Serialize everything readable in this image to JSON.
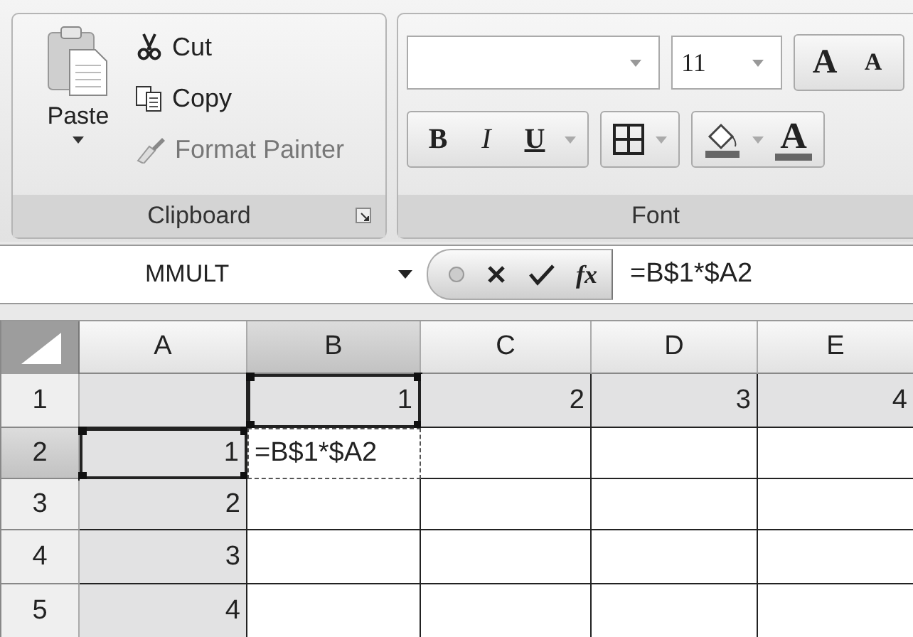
{
  "ribbon": {
    "clipboard": {
      "paste": "Paste",
      "items": [
        {
          "kind": "cut",
          "label": "Cut",
          "disabled": false
        },
        {
          "kind": "copy",
          "label": "Copy",
          "disabled": false
        },
        {
          "kind": "painter",
          "label": "Format Painter",
          "disabled": true
        }
      ],
      "title": "Clipboard"
    },
    "font": {
      "size": "11",
      "grow": "A",
      "shrink": "A",
      "styles": [
        {
          "kind": "bold",
          "label": "B"
        },
        {
          "kind": "italic",
          "label": "I"
        },
        {
          "kind": "underline",
          "label": "U"
        }
      ],
      "font_color": "A",
      "title": "Font"
    }
  },
  "formula_bar": {
    "name_box": "MMULT",
    "function_label": "fx",
    "formula": "=B$1*$A2"
  },
  "grid": {
    "columns": [
      {
        "label": "A",
        "selected": false
      },
      {
        "label": "B",
        "selected": true
      },
      {
        "label": "C",
        "selected": false
      },
      {
        "label": "D",
        "selected": false
      },
      {
        "label": "E",
        "selected": false
      }
    ],
    "rows": [
      {
        "label": "1",
        "selected": false,
        "cells": [
          {
            "kind": "plain",
            "highlighted": true
          },
          {
            "value": "1",
            "kind": "reference",
            "highlighted": true
          },
          {
            "value": "2",
            "kind": "plain",
            "highlighted": true
          },
          {
            "value": "3",
            "kind": "plain",
            "highlighted": true
          },
          {
            "value": "4",
            "kind": "plain",
            "highlighted": true
          }
        ]
      },
      {
        "label": "2",
        "selected": true,
        "cells": [
          {
            "value": "1",
            "kind": "reference",
            "highlighted": true
          },
          {
            "value": "=B$1*$A2",
            "kind": "editing",
            "highlighted": false
          },
          {
            "kind": "plain",
            "highlighted": false
          },
          {
            "kind": "plain",
            "highlighted": false
          },
          {
            "kind": "plain",
            "highlighted": false
          }
        ]
      },
      {
        "label": "3",
        "selected": false,
        "cells": [
          {
            "value": "2",
            "kind": "plain",
            "highlighted": true
          },
          {
            "kind": "plain",
            "highlighted": false
          },
          {
            "kind": "plain",
            "highlighted": false
          },
          {
            "kind": "plain",
            "highlighted": false
          },
          {
            "kind": "plain",
            "highlighted": false
          }
        ]
      },
      {
        "label": "4",
        "selected": false,
        "cells": [
          {
            "value": "3",
            "kind": "plain",
            "highlighted": true
          },
          {
            "kind": "plain",
            "highlighted": false
          },
          {
            "kind": "plain",
            "highlighted": false
          },
          {
            "kind": "plain",
            "highlighted": false
          },
          {
            "kind": "plain",
            "highlighted": false
          }
        ]
      },
      {
        "label": "5",
        "selected": false,
        "cells": [
          {
            "value": "4",
            "kind": "plain",
            "highlighted": true
          },
          {
            "kind": "plain",
            "highlighted": false
          },
          {
            "kind": "plain",
            "highlighted": false
          },
          {
            "kind": "plain",
            "highlighted": false
          },
          {
            "kind": "plain",
            "highlighted": false
          }
        ]
      }
    ]
  }
}
